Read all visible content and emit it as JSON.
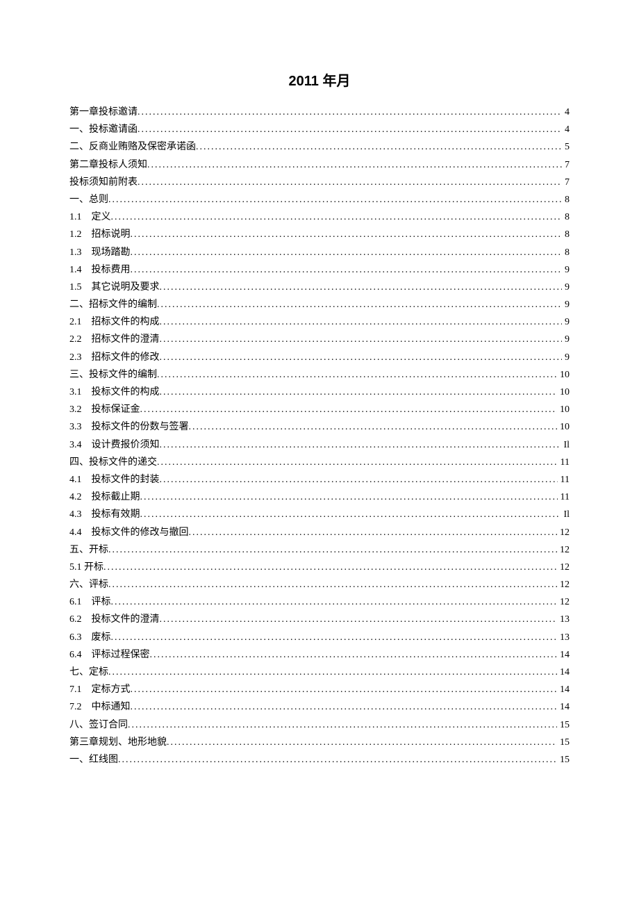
{
  "title": "2011 年月",
  "toc": [
    {
      "num": "",
      "text": "第一章投标邀请",
      "page": "4",
      "indent": false
    },
    {
      "num": "",
      "text": "一、投标邀请函",
      "page": "4",
      "indent": false
    },
    {
      "num": "",
      "text": "二、反商业贿赂及保密承诺函",
      "page": "5",
      "indent": false
    },
    {
      "num": "",
      "text": "第二章投标人须知",
      "page": "7",
      "indent": false
    },
    {
      "num": "",
      "text": "投标须知前附表",
      "page": "7",
      "indent": false
    },
    {
      "num": "",
      "text": "一、总则",
      "page": "8",
      "indent": false
    },
    {
      "num": "1.1",
      "text": "定义",
      "page": "8",
      "indent": true
    },
    {
      "num": "1.2",
      "text": "招标说明",
      "page": "8",
      "indent": true
    },
    {
      "num": "1.3",
      "text": "现场踏勘",
      "page": "8",
      "indent": true
    },
    {
      "num": "1.4",
      "text": "投标费用",
      "page": "9",
      "indent": true
    },
    {
      "num": "1.5",
      "text": "其它说明及要求",
      "page": "9",
      "indent": true
    },
    {
      "num": "",
      "text": "二、招标文件的编制",
      "page": "9",
      "indent": false
    },
    {
      "num": "2.1",
      "text": "招标文件的构成",
      "page": "9",
      "indent": true
    },
    {
      "num": "2.2",
      "text": "招标文件的澄清",
      "page": "9",
      "indent": true
    },
    {
      "num": "2.3",
      "text": "招标文件的修改",
      "page": "9",
      "indent": true
    },
    {
      "num": "",
      "text": "三、投标文件的编制",
      "page": "10",
      "indent": false
    },
    {
      "num": "3.1",
      "text": "投标文件的构成",
      "page": "10",
      "indent": true
    },
    {
      "num": "3.2",
      "text": "投标保证金",
      "page": "10",
      "indent": true
    },
    {
      "num": "3.3",
      "text": "投标文件的份数与签署",
      "page": "10",
      "indent": true
    },
    {
      "num": "3.4",
      "text": "设计费报价须知",
      "page": "Il",
      "indent": true
    },
    {
      "num": "",
      "text": "四、投标文件的递交",
      "page": "11",
      "indent": false
    },
    {
      "num": "4.1",
      "text": "投标文件的封装",
      "page": "11",
      "indent": true
    },
    {
      "num": "4.2",
      "text": "投标截止期",
      "page": "11",
      "indent": true
    },
    {
      "num": "4.3",
      "text": "投标有效期",
      "page": "Il",
      "indent": true
    },
    {
      "num": "4.4",
      "text": "投标文件的修改与撤回",
      "page": "12",
      "indent": true
    },
    {
      "num": "",
      "text": "五、开标",
      "page": "12",
      "indent": false
    },
    {
      "num": "",
      "text": "5.1 开标",
      "page": "12",
      "indent": false
    },
    {
      "num": "",
      "text": "六、评标",
      "page": "12",
      "indent": false
    },
    {
      "num": "6.1",
      "text": "评标",
      "page": "12",
      "indent": true
    },
    {
      "num": "6.2",
      "text": "投标文件的澄清",
      "page": "13",
      "indent": true
    },
    {
      "num": "6.3",
      "text": "废标",
      "page": "13",
      "indent": true
    },
    {
      "num": "6.4",
      "text": "评标过程保密",
      "page": "14",
      "indent": true
    },
    {
      "num": "",
      "text": "七、定标",
      "page": "14",
      "indent": false
    },
    {
      "num": "7.1",
      "text": "定标方式",
      "page": "14",
      "indent": true
    },
    {
      "num": "7.2",
      "text": "中标通知",
      "page": "14",
      "indent": true
    },
    {
      "num": "",
      "text": "八、签订合同",
      "page": "15",
      "indent": false
    },
    {
      "num": "",
      "text": "第三章规划、地形地貌",
      "page": "15",
      "indent": false
    },
    {
      "num": "",
      "text": "一、红线图",
      "page": "15",
      "indent": false
    }
  ]
}
